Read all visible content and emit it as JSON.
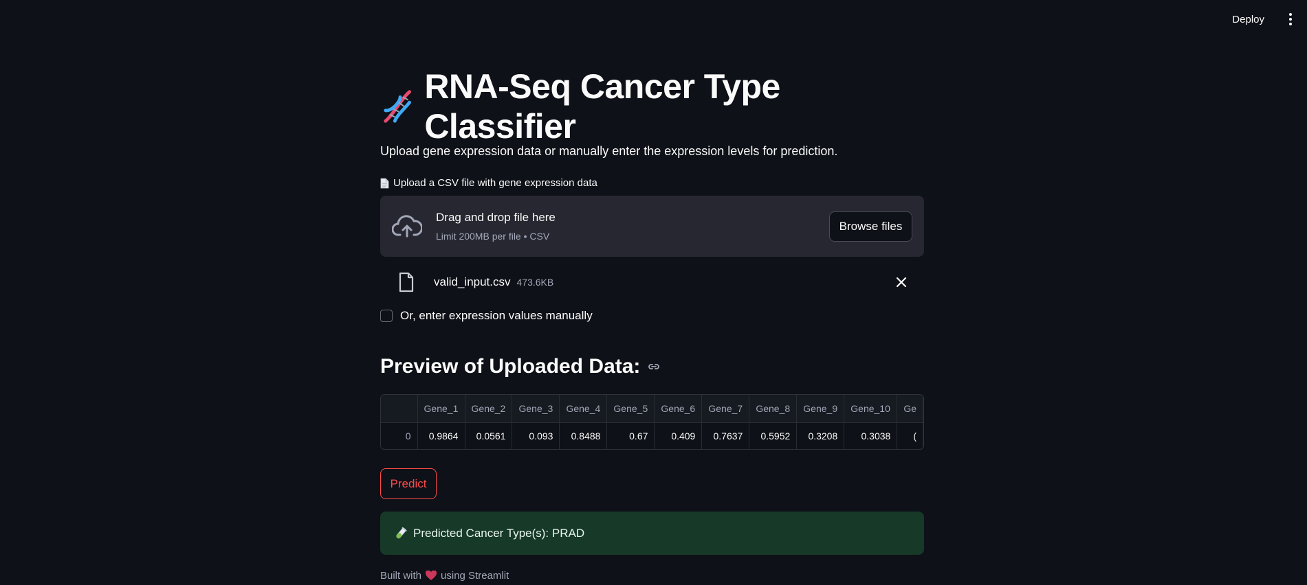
{
  "header": {
    "deploy_label": "Deploy",
    "menu_icon": "kebab-menu-icon"
  },
  "app": {
    "title": "RNA-Seq Cancer Type Classifier",
    "title_icon": "dna-icon",
    "subtitle": "Upload gene expression data or manually enter the expression levels for prediction."
  },
  "uploader": {
    "label": "Upload a CSV file with gene expression data",
    "label_icon": "document-icon",
    "drop_text": "Drag and drop file here",
    "limit_text": "Limit 200MB per file • CSV",
    "browse_label": "Browse files",
    "file": {
      "name": "valid_input.csv",
      "size": "473.6KB"
    }
  },
  "manual_entry": {
    "label": "Or, enter expression values manually",
    "checked": false
  },
  "preview": {
    "heading": "Preview of Uploaded Data:",
    "columns": [
      "",
      "Gene_1",
      "Gene_2",
      "Gene_3",
      "Gene_4",
      "Gene_5",
      "Gene_6",
      "Gene_7",
      "Gene_8",
      "Gene_9",
      "Gene_10",
      "Ge"
    ],
    "rows": [
      [
        "0",
        "0.9864",
        "0.0561",
        "0.093",
        "0.8488",
        "0.67",
        "0.409",
        "0.7637",
        "0.5952",
        "0.3208",
        "0.3038",
        "("
      ]
    ]
  },
  "predict_label": "Predict",
  "result": {
    "icon": "test-tube-icon",
    "text": "Predicted Cancer Type(s): PRAD"
  },
  "footer": {
    "prefix": "Built with",
    "icon": "heart-icon",
    "suffix": "using Streamlit"
  },
  "colors": {
    "background": "#0e1117",
    "accent": "#ff4b4b",
    "success_bg": "#173928",
    "panel": "#262730"
  }
}
